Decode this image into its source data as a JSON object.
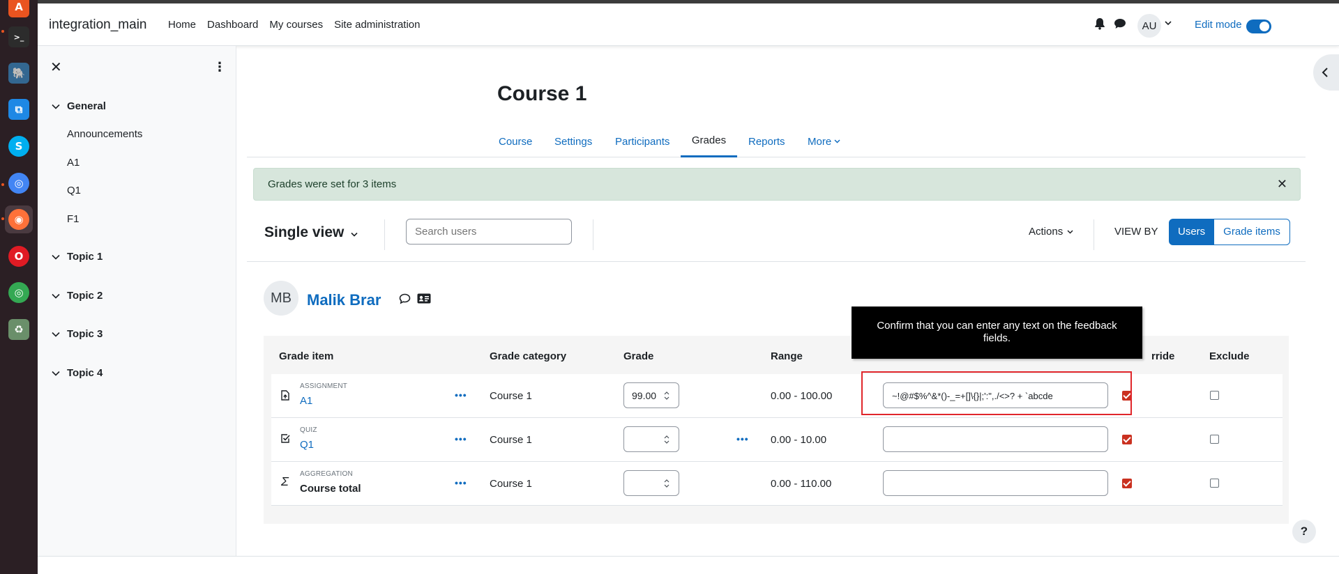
{
  "dock": {
    "items": [
      {
        "icon": "ubuntu-software-icon",
        "glyph": "A",
        "color": "#e95420"
      },
      {
        "icon": "terminal-icon",
        "glyph": ">_",
        "color": "#2c2c2c"
      },
      {
        "icon": "pgadmin-elephant-icon",
        "glyph": "🐘",
        "color": "#336791"
      },
      {
        "icon": "vscode-icon",
        "glyph": "⧉",
        "color": "#1e88e5"
      },
      {
        "icon": "skype-icon",
        "glyph": "S",
        "color": "#00aff0"
      },
      {
        "icon": "chromium-icon",
        "glyph": "◎",
        "color": "#4285f4"
      },
      {
        "icon": "firefox-icon",
        "glyph": "◉",
        "color": "#ff7139"
      },
      {
        "icon": "opera-icon",
        "glyph": "O",
        "color": "#e01b24"
      },
      {
        "icon": "chrome-icon",
        "glyph": "◎",
        "color": "#34a853"
      },
      {
        "icon": "trash-icon",
        "glyph": "♻",
        "color": "#6a8f6a"
      }
    ]
  },
  "navbar": {
    "brand": "integration_main",
    "links": [
      "Home",
      "Dashboard",
      "My courses",
      "Site administration"
    ],
    "avatar": "AU",
    "edit_mode": "Edit mode",
    "edit_mode_on": true
  },
  "drawer": {
    "sections": [
      {
        "title": "General",
        "expanded": true,
        "activities": [
          "Announcements",
          "A1",
          "Q1",
          "F1"
        ]
      },
      {
        "title": "Topic 1",
        "expanded": true
      },
      {
        "title": "Topic 2",
        "expanded": true
      },
      {
        "title": "Topic 3",
        "expanded": true
      },
      {
        "title": "Topic 4",
        "expanded": true
      }
    ]
  },
  "course": {
    "title": "Course 1",
    "tabs": [
      "Course",
      "Settings",
      "Participants",
      "Grades",
      "Reports",
      "More"
    ],
    "active_tab": "Grades"
  },
  "alert": {
    "text": "Grades were set for 3 items",
    "color": "#d7e6dc"
  },
  "toolbar": {
    "title": "Single view",
    "search_placeholder": "Search users",
    "actions": "Actions",
    "view_by": "VIEW BY",
    "view_users": "Users",
    "view_items": "Grade items"
  },
  "user": {
    "initials": "MB",
    "name": "Malik Brar"
  },
  "table": {
    "headers": {
      "item": "Grade item",
      "category": "Grade category",
      "grade": "Grade",
      "range": "Range",
      "override": "rride",
      "exclude": "Exclude"
    },
    "rows": [
      {
        "type": "ASSIGNMENT",
        "name": "A1",
        "icon": "assignment-icon",
        "category": "Course 1",
        "grade": "99.00",
        "range": "0.00 - 100.00",
        "feedback": "~!@#$%^&*()-_=+[]\\{}|;':\",./<>? + `abcde",
        "override": true,
        "exclude": false
      },
      {
        "type": "QUIZ",
        "name": "Q1",
        "icon": "quiz-icon",
        "category": "Course 1",
        "grade": "",
        "range": "0.00 - 10.00",
        "feedback": "",
        "override": true,
        "exclude": false
      },
      {
        "type": "AGGREGATION",
        "name": "Course total",
        "icon": "sigma-icon",
        "category": "Course 1",
        "grade": "",
        "range": "0.00 - 110.00",
        "feedback": "",
        "override": true,
        "exclude": false
      }
    ]
  },
  "tooltip": {
    "text": "Confirm that you can enter any text on the feedback fields."
  },
  "help": "?",
  "colors": {
    "primary": "#0f6cbf",
    "danger": "#ca3120",
    "highlight": "#e0262b"
  }
}
